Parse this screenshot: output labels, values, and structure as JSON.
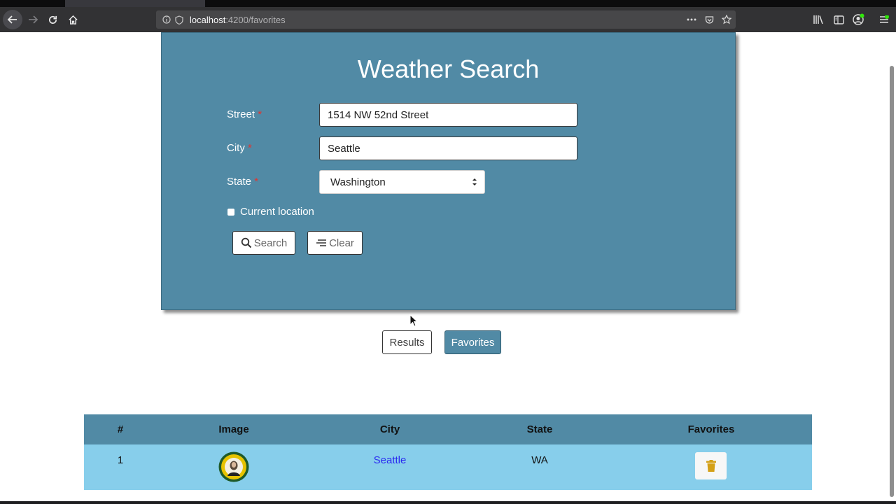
{
  "browser": {
    "url_host": "localhost",
    "url_path": ":4200/favorites"
  },
  "page": {
    "title": "Weather Search",
    "form": {
      "street_label": "Street",
      "street_value": "1514 NW 52nd Street",
      "city_label": "City",
      "city_value": "Seattle",
      "state_label": "State",
      "state_value": "Washington",
      "required_mark": "*",
      "current_location_label": "Current location",
      "search_label": "Search",
      "clear_label": "Clear"
    },
    "tabs": {
      "results_label": "Results",
      "favorites_label": "Favorites"
    },
    "table": {
      "headers": [
        "#",
        "Image",
        "City",
        "State",
        "Favorites"
      ],
      "rows": [
        {
          "index": "1",
          "city": "Seattle",
          "state": "WA"
        }
      ]
    }
  },
  "colors": {
    "panel": "#518aa5",
    "row": "#87ceeb",
    "required": "#e3342f",
    "link": "#2a2af0",
    "trash": "#d4a017"
  }
}
